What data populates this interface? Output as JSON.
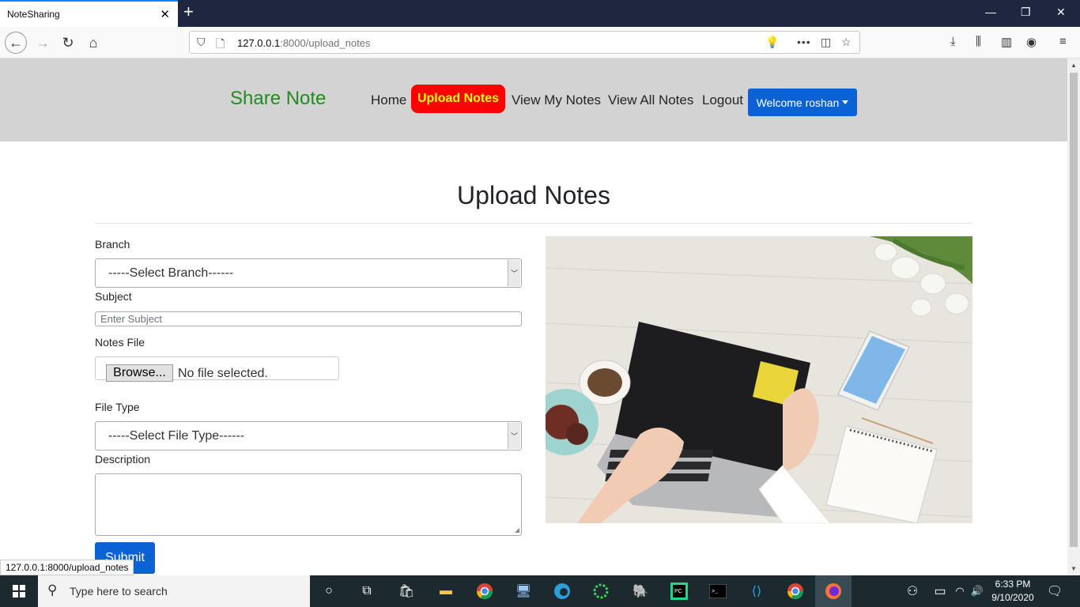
{
  "browser": {
    "tab_title": "NoteSharing",
    "url_host": "127.0.0.1",
    "url_rest": ":8000/upload_notes",
    "status_url": "127.0.0.1:8000/upload_notes"
  },
  "site": {
    "brand": "Share Note",
    "menu": [
      "Home",
      "Upload Notes",
      "View My Notes",
      "View All Notes",
      "Logout"
    ],
    "active_menu": "Upload Notes",
    "welcome": "Welcome roshan"
  },
  "form": {
    "title": "Upload Notes",
    "branch_label": "Branch",
    "branch_value": "-----Select Branch------",
    "subject_label": "Subject",
    "subject_placeholder": "Enter Subject",
    "file_label": "Notes File",
    "browse_label": "Browse...",
    "file_status": "No file selected.",
    "filetype_label": "File Type",
    "filetype_value": "-----Select File Type------",
    "description_label": "Description",
    "submit_label": "Submit"
  },
  "taskbar": {
    "search_placeholder": "Type here to search",
    "time": "6:33 PM",
    "date": "9/10/2020"
  },
  "colors": {
    "header_bg": "#d3d3d3",
    "brand": "#228b22",
    "active_menu_bg": "#ff0000",
    "active_menu_text": "#ffff00",
    "primary_button": "#0a62d4"
  }
}
